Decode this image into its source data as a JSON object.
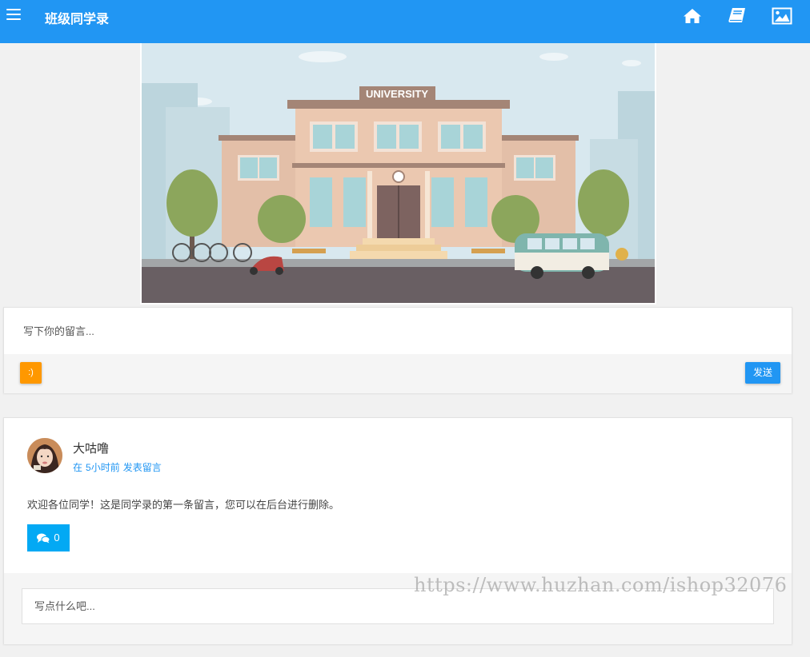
{
  "header": {
    "title": "班级同学录",
    "icons": [
      "menu-icon",
      "home-icon",
      "book-icon",
      "image-icon"
    ],
    "bg_color": "#2196f3"
  },
  "banner": {
    "sign_text": "UNIVERSITY"
  },
  "compose": {
    "placeholder": "写下你的留言...",
    "emoji_label": ":)",
    "send_label": "发送"
  },
  "post": {
    "author": "大咕噜",
    "meta_prefix": "在",
    "meta_time": "5小时前",
    "meta_suffix": "发表留言",
    "body": "欢迎各位同学！这是同学录的第一条留言，您可以在后台进行删除。",
    "comment_count": "0",
    "reply_placeholder": "写点什么吧..."
  },
  "watermark": "https://www.huzhan.com/ishop32076",
  "colors": {
    "primary": "#2196f3",
    "accent_orange": "#ff9800",
    "comment_blue": "#03a9f4"
  }
}
